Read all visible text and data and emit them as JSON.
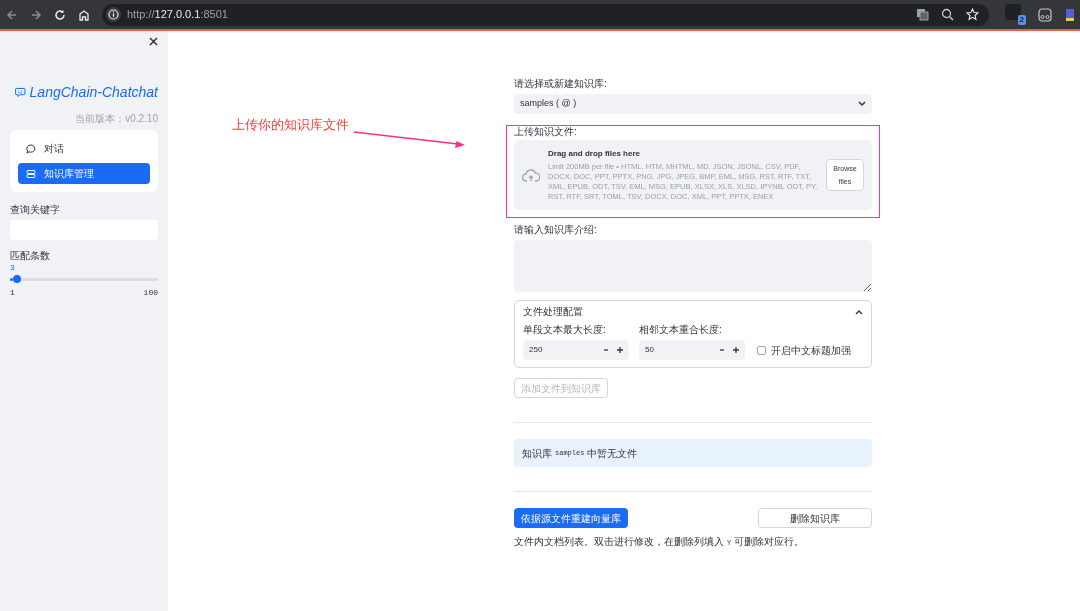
{
  "browser": {
    "url_scheme": "http://",
    "url_host": "127.0.0.1",
    "url_port": ":8501",
    "extension_badge": "2"
  },
  "sidebar": {
    "logo_text": "LangChain-Chatchat",
    "version": "当前版本：v0.2.10",
    "nav": [
      {
        "label": "对话",
        "selected": false,
        "kind": "chat"
      },
      {
        "label": "知识库管理",
        "selected": true,
        "kind": "database"
      }
    ],
    "search_label": "查询关键字",
    "slider": {
      "label": "匹配条数",
      "value": "3",
      "min": "1",
      "max": "100",
      "level": 0.02
    }
  },
  "annotation": {
    "text": "上传你的知识库文件"
  },
  "main": {
    "kb_select": {
      "label": "请选择或新建知识库:",
      "value": "samples ( @ )"
    },
    "uploader": {
      "label": "上传知识文件:",
      "title": "Drag and drop files here",
      "limits": "Limit 200MB per file • HTML, HTM, MHTML, MD, JSON, JSONL, CSV, PDF, DOCX, DOC, PPT, PPTX, PNG, JPG, JPEG, BMP, EML, MSG, RST, RTF, TXT, XML, EPUB, ODT, TSV, EML, MSG, EPUB, XLSX, XLS, XLSD, IPYNB, ODT, PY, RST, RTF, SRT, TOML, TSV, DOCX, DOC, XML, PPT, PPTX, ENEX",
      "button": "Browse files"
    },
    "intro_label": "请输入知识库介绍:",
    "expander": {
      "title": "文件处理配置",
      "expanded": true,
      "fields": [
        {
          "label": "单段文本最大长度:",
          "value": "250"
        },
        {
          "label": "相邻文本重合长度:",
          "value": "50"
        }
      ],
      "checkbox": {
        "label": "开启中文标题加强",
        "checked": false
      }
    },
    "add_button": {
      "label": "添加文件到知识库",
      "disabled": true
    },
    "info": {
      "before": "知识库",
      "code": "samples",
      "after": "中暂无文件"
    },
    "rebuild_button": "依据源文件重建向量库",
    "delete_button": "删除知识库",
    "caption": {
      "before": "文件内文档列表。双击进行修改，在删除列填入",
      "code": "Y",
      "after": "可删除对应行。"
    }
  }
}
